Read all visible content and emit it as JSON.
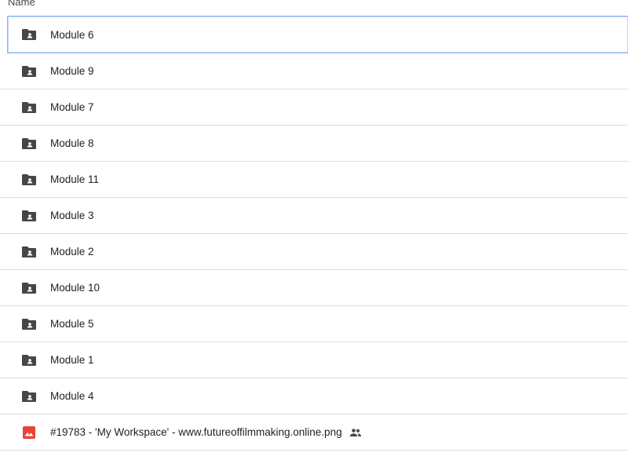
{
  "header": {
    "name_column": "Name"
  },
  "files": [
    {
      "name": "Module 6",
      "icon": "shared-folder-icon",
      "selected": true
    },
    {
      "name": "Module 9",
      "icon": "shared-folder-icon"
    },
    {
      "name": "Module 7",
      "icon": "shared-folder-icon"
    },
    {
      "name": "Module 8",
      "icon": "shared-folder-icon"
    },
    {
      "name": "Module 11",
      "icon": "shared-folder-icon"
    },
    {
      "name": "Module 3",
      "icon": "shared-folder-icon"
    },
    {
      "name": "Module 2",
      "icon": "shared-folder-icon"
    },
    {
      "name": "Module 10",
      "icon": "shared-folder-icon"
    },
    {
      "name": "Module 5",
      "icon": "shared-folder-icon"
    },
    {
      "name": "Module 1",
      "icon": "shared-folder-icon"
    },
    {
      "name": "Module 4",
      "icon": "shared-folder-icon"
    },
    {
      "name": "#19783 - 'My Workspace' - www.futureoffilmmaking.online.png",
      "icon": "image-file-icon",
      "shared_icon": "people-icon"
    }
  ],
  "colors": {
    "folder": "#444746",
    "image_icon": "#ea4335",
    "divider": "#dadce0",
    "selection_border": "#8ab4f8"
  }
}
